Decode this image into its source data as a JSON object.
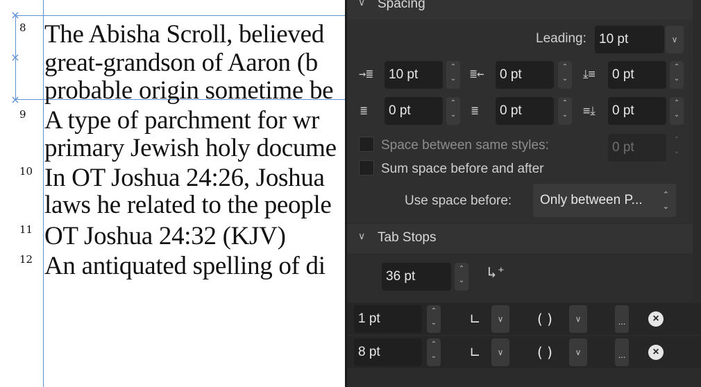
{
  "document": {
    "footnotes": [
      {
        "number": "8",
        "lines": [
          "The Abisha Scroll, believed",
          "great-grandson of Aaron (b",
          "probable origin sometime be"
        ]
      },
      {
        "number": "9",
        "lines": [
          "A type of parchment for wr",
          "primary Jewish holy docume"
        ]
      },
      {
        "number": "10",
        "lines": [
          "In OT Joshua 24:26, Joshua",
          "laws he related to the people"
        ]
      },
      {
        "number": "11",
        "lines": [
          "OT Joshua 24:32 (KJV)"
        ]
      },
      {
        "number": "12",
        "lines": [
          "An antiquated spelling of di"
        ]
      }
    ]
  },
  "panel": {
    "spacing": {
      "title": "Spacing",
      "leading_label": "Leading:",
      "leading_value": "10 pt",
      "indent_left": "10 pt",
      "indent_right": "0 pt",
      "space_before": "0 pt",
      "first_line": "0 pt",
      "last_line": "0 pt",
      "space_after": "0 pt",
      "same_styles_label": "Space between same styles:",
      "same_styles_value": "0 pt",
      "sum_space_label": "Sum space before and after",
      "use_space_before_label": "Use space before:",
      "use_space_before_value": "Only between P..."
    },
    "tab_stops": {
      "title": "Tab Stops",
      "default_value": "36 pt",
      "rows": [
        {
          "position": "1 pt",
          "align_glyph": "∟",
          "leader_glyph": "( )",
          "more": "..."
        },
        {
          "position": "8 pt",
          "align_glyph": "∟",
          "leader_glyph": "( )",
          "more": "..."
        }
      ]
    }
  }
}
